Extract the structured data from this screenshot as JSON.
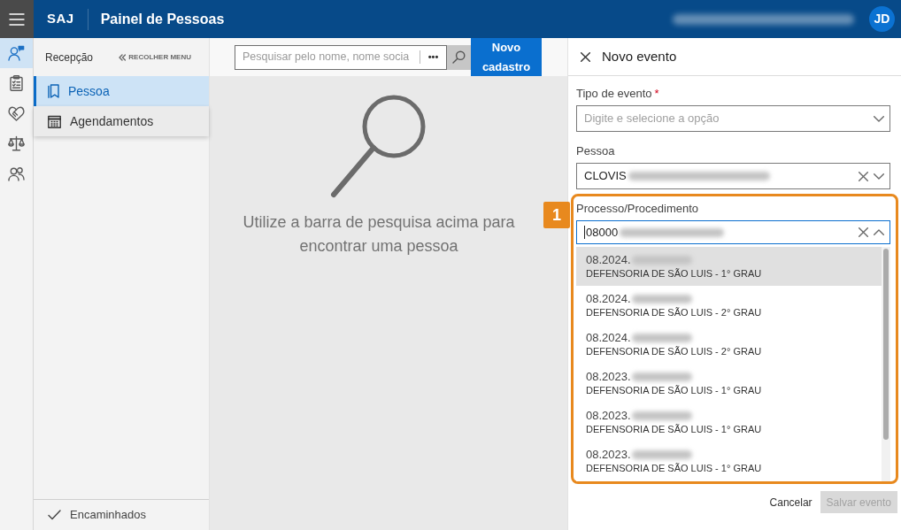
{
  "app_bar": {
    "product": "SAJ",
    "title": "Painel de Pessoas",
    "user_redacted": true,
    "avatar_initials": "JD"
  },
  "icon_rail": [
    {
      "kind": "person-chat",
      "selected": true
    },
    {
      "kind": "clipboard",
      "selected": false
    },
    {
      "kind": "heart",
      "selected": false
    },
    {
      "kind": "scales",
      "selected": false
    },
    {
      "kind": "people",
      "selected": false
    }
  ],
  "side_menu": {
    "title": "Recepção",
    "collapse_label": "RECOLHER MENU",
    "items": [
      {
        "kind": "bookmark",
        "label": "Pessoa",
        "selected": true,
        "hovered": false
      },
      {
        "kind": "calendar",
        "label": "Agendamentos",
        "selected": false,
        "hovered": true
      }
    ],
    "footer_item": {
      "kind": "check",
      "label": "Encaminhados"
    }
  },
  "search": {
    "placeholder": "Pesquisar pelo nome, nome socia",
    "more_label": "•••",
    "new_button": "Novo cadastro"
  },
  "empty_state": {
    "message": "Utilize a barra de pesquisa acima para encontrar uma pessoa"
  },
  "panel": {
    "title": "Novo evento",
    "fields": [
      {
        "label": "Tipo de evento",
        "required_mark": "*",
        "placeholder": "Digite e selecione a opção",
        "clearable": false,
        "expanded": false,
        "focused": false
      },
      {
        "label": "Pessoa",
        "value": "CLOVIS",
        "redacted": true,
        "clearable": true,
        "expanded": false,
        "focused": false
      },
      {
        "label": "Processo/Procedimento",
        "value": "08000",
        "redacted": true,
        "clearable": true,
        "expanded": true,
        "focused": true,
        "annotation": "1",
        "options": [
          {
            "number": "08.2024.",
            "redacted": true,
            "court": "DEFENSORIA DE SÃO LUIS - 1° GRAU",
            "selected": true
          },
          {
            "number": "08.2024.",
            "redacted": true,
            "court": "DEFENSORIA DE SÃO LUIS - 2° GRAU",
            "selected": false
          },
          {
            "number": "08.2024.",
            "redacted": true,
            "court": "DEFENSORIA DE SÃO LUIS - 2° GRAU",
            "selected": false
          },
          {
            "number": "08.2023.",
            "redacted": true,
            "court": "DEFENSORIA DE SÃO LUIS - 1° GRAU",
            "selected": false
          },
          {
            "number": "08.2023.",
            "redacted": true,
            "court": "DEFENSORIA DE SÃO LUIS - 1° GRAU",
            "selected": false
          },
          {
            "number": "08.2023.",
            "redacted": true,
            "court": "DEFENSORIA DE SÃO LUIS - 1° GRAU",
            "selected": false
          }
        ]
      }
    ],
    "cancel_label": "Cancelar",
    "save_label": "Salvar evento",
    "save_disabled": true
  }
}
